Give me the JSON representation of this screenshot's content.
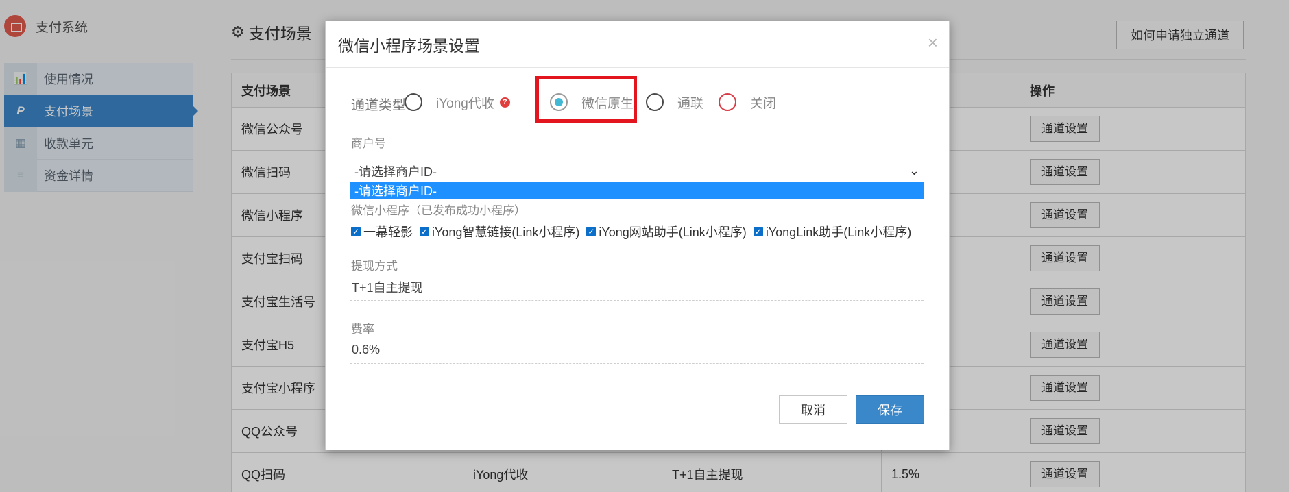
{
  "app": {
    "brand": "支付系统"
  },
  "sidebar": {
    "items": [
      {
        "label": "使用情况",
        "icon": "bar-chart-icon",
        "glyph": "📊"
      },
      {
        "label": "支付场景",
        "icon": "paypal-icon",
        "glyph": "P"
      },
      {
        "label": "收款单元",
        "icon": "grid-icon",
        "glyph": "▦"
      },
      {
        "label": "资金详情",
        "icon": "list-icon",
        "glyph": "≡"
      }
    ],
    "active_index": 1
  },
  "page": {
    "title": "支付场景",
    "apply_button": "如何申请独立通道"
  },
  "table": {
    "headers": [
      "支付场景",
      "",
      "",
      "",
      "操作"
    ],
    "rows": [
      [
        "微信公众号",
        "",
        "",
        ""
      ],
      [
        "微信扫码",
        "",
        "",
        ""
      ],
      [
        "微信小程序",
        "",
        "",
        ""
      ],
      [
        "支付宝扫码",
        "",
        "",
        ""
      ],
      [
        "支付宝生活号",
        "",
        "",
        ""
      ],
      [
        "支付宝H5",
        "",
        "",
        ""
      ],
      [
        "支付宝小程序",
        "",
        "",
        ""
      ],
      [
        "QQ公众号",
        "",
        "",
        ""
      ],
      [
        "QQ扫码",
        "iYong代收",
        "T+1自主提现",
        "1.5%"
      ]
    ],
    "action_label": "通道设置"
  },
  "modal": {
    "title": "微信小程序场景设置",
    "close_glyph": "×",
    "channel_type_label": "通道类型",
    "channel_options": [
      {
        "label": "iYong代收",
        "checked": false
      },
      {
        "label": "微信原生",
        "checked": true
      },
      {
        "label": "通联",
        "checked": false
      },
      {
        "label": "关闭",
        "checked": false
      }
    ],
    "help_glyph": "?",
    "merchant_label": "商户号",
    "merchant_value": "-请选择商户ID-",
    "merchant_dropdown_option": "-请选择商户ID-",
    "mini_program_label": "微信小程序（已发布成功小程序）",
    "mini_programs": [
      {
        "label": "一幕轻影",
        "checked": true
      },
      {
        "label": "iYong智慧链接(Link小程序)",
        "checked": true
      },
      {
        "label": "iYong网站助手(Link小程序)",
        "checked": true
      },
      {
        "label": "iYongLink助手(Link小程序)",
        "checked": true
      }
    ],
    "withdraw_label": "提现方式",
    "withdraw_value": "T+1自主提现",
    "rate_label": "费率",
    "rate_value": "0.6%",
    "cancel_label": "取消",
    "save_label": "保存"
  },
  "colors": {
    "accent": "#3a87c9",
    "radio_checked": "#43b8d4",
    "highlight_box": "#e3161f",
    "dropdown_selected": "#1e90ff"
  }
}
